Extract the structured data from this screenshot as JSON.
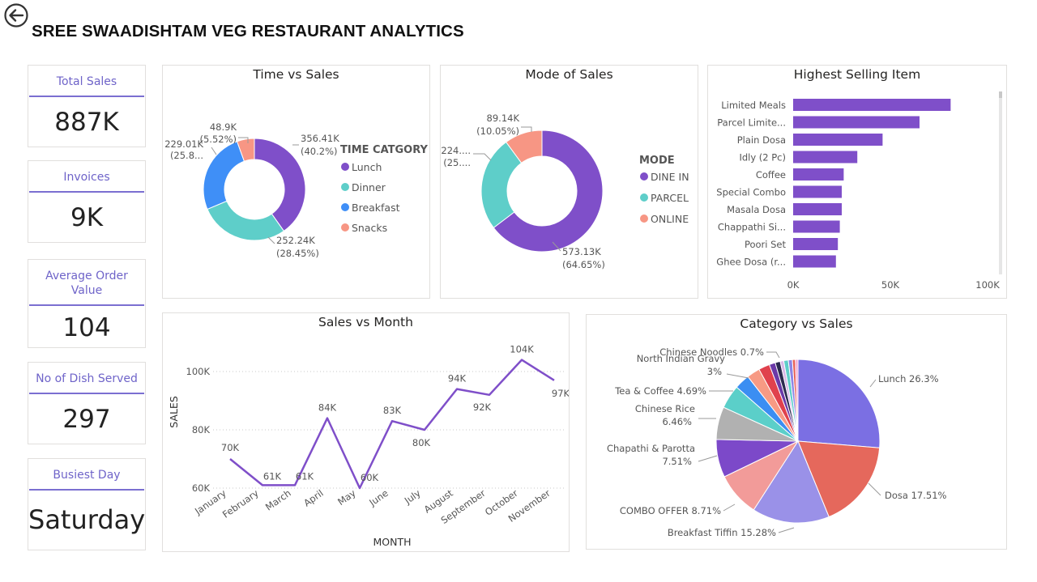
{
  "title": "SREE SWAADISHTAM VEG RESTAURANT ANALYTICS",
  "icons": {
    "back": "back-arrow-icon"
  },
  "colors": {
    "purple": "#7f4fc9",
    "teal": "#5ecec9",
    "blue": "#3f8ff7",
    "salmon": "#f79684",
    "kpi_accent": "#7b6fd1"
  },
  "kpis": [
    {
      "label": "Total Sales",
      "value": "887K"
    },
    {
      "label": "Invoices",
      "value": "9K"
    },
    {
      "label_lines": [
        "Average Order",
        "Value"
      ],
      "value": "104"
    },
    {
      "label": "No of Dish Served",
      "value": "297"
    },
    {
      "label": "Busiest Day",
      "value": "Saturday"
    }
  ],
  "chart_data": [
    {
      "type": "pie",
      "title": "Time vs Sales",
      "legend_title": "TIME CATGORY",
      "legend_position": "right",
      "slices": [
        {
          "name": "Lunch",
          "value": 356.41,
          "value_label": "356.41K",
          "pct_label": "(40.2%)",
          "pct": 40.2
        },
        {
          "name": "Dinner",
          "value": 252.24,
          "value_label": "252.24K",
          "pct_label": "(28.45%)",
          "pct": 28.45
        },
        {
          "name": "Breakfast",
          "value": 229.01,
          "value_label": "229.01K",
          "pct_label": "(25.8...",
          "pct": 25.83
        },
        {
          "name": "Snacks",
          "value": 48.9,
          "value_label": "48.9K",
          "pct_label": "(5.52%)",
          "pct": 5.52
        }
      ]
    },
    {
      "type": "pie",
      "title": "Mode of Sales",
      "legend_title": "MODE",
      "legend_position": "right",
      "slices": [
        {
          "name": "DINE IN",
          "value": 573.13,
          "value_label": "573.13K",
          "pct_label": "(64.65%)",
          "pct": 64.65
        },
        {
          "name": "PARCEL",
          "value": 224,
          "value_label": "224....",
          "pct_label": "(25....",
          "pct": 25.3
        },
        {
          "name": "ONLINE",
          "value": 89.14,
          "value_label": "89.14K",
          "pct_label": "(10.05%)",
          "pct": 10.05
        }
      ]
    },
    {
      "type": "bar",
      "orientation": "horizontal",
      "title": "Highest Selling Item",
      "categories": [
        "Limited Meals",
        "Parcel Limite...",
        "Plain Dosa",
        "Idly (2 Pc)",
        "Coffee",
        "Special Combo",
        "Masala Dosa",
        "Chappathi Si...",
        "Poori Set",
        "Ghee Dosa (r..."
      ],
      "values": [
        81,
        65,
        46,
        33,
        26,
        25,
        25,
        24,
        23,
        22
      ],
      "xlim": [
        0,
        100
      ],
      "xticks": [
        "0K",
        "50K",
        "100K"
      ],
      "gridlines": false
    },
    {
      "type": "line",
      "title": "Sales vs Month",
      "xlabel": "MONTH",
      "ylabel": "SALES",
      "categories": [
        "January",
        "February",
        "March",
        "April",
        "May",
        "June",
        "July",
        "August",
        "September",
        "October",
        "November"
      ],
      "values": [
        70,
        61,
        61,
        84,
        60,
        83,
        80,
        94,
        92,
        104,
        97
      ],
      "data_labels": [
        "70K",
        "61K",
        "61K",
        "84K",
        "60K",
        "83K",
        "80K",
        "94K",
        "92K",
        "104K",
        "97K"
      ],
      "ylim": [
        60,
        104
      ],
      "yticks": [
        {
          "v": 60,
          "label": "60K"
        },
        {
          "v": 80,
          "label": "80K"
        },
        {
          "v": 100,
          "label": "100K"
        }
      ],
      "grid": true
    },
    {
      "type": "pie",
      "title": "Category vs Sales",
      "slices": [
        {
          "name": "Lunch",
          "pct": 26.3,
          "label": "Lunch 26.3%",
          "color": "#7b6fe3"
        },
        {
          "name": "Dosa",
          "pct": 17.51,
          "label": "Dosa 17.51%",
          "color": "#e5685c"
        },
        {
          "name": "Breakfast Tiffin",
          "pct": 15.28,
          "label": "Breakfast Tiffin 15.28%",
          "color": "#9a91e8"
        },
        {
          "name": "COMBO OFFER",
          "pct": 8.71,
          "label": "COMBO OFFER 8.71%",
          "color": "#f29b99"
        },
        {
          "name": "Chapathi & Parotta",
          "pct": 7.51,
          "label_lines": [
            "Chapathi & Parotta",
            "7.51%"
          ],
          "color": "#7c49c9"
        },
        {
          "name": "Chinese Rice",
          "pct": 6.46,
          "label_lines": [
            "Chinese Rice",
            "6.46%"
          ],
          "color": "#b1b1b1"
        },
        {
          "name": "Tea & Coffee",
          "pct": 4.69,
          "label": "Tea & Coffee 4.69%",
          "color": "#5bcfc9"
        },
        {
          "name": "North Indian Gravy",
          "pct": 3,
          "label_lines": [
            "North Indian Gravy",
            "3%"
          ],
          "color": "#3b8ef2"
        },
        {
          "name": "s9",
          "pct": 2.6,
          "color": "#f79a84"
        },
        {
          "name": "s10",
          "pct": 2.2,
          "color": "#e0414d"
        },
        {
          "name": "s11",
          "pct": 1.2,
          "color": "#6b3aa8"
        },
        {
          "name": "s12",
          "pct": 1.0,
          "color": "#2b2b4f"
        },
        {
          "name": "Chinese Noodles",
          "pct": 0.7,
          "label": "Chinese Noodles 0.7%",
          "color": "#d9b7e8"
        },
        {
          "name": "s14",
          "pct": 0.9,
          "color": "#5ecec9"
        },
        {
          "name": "s15",
          "pct": 0.8,
          "color": "#8d84e6"
        },
        {
          "name": "s16",
          "pct": 0.6,
          "color": "#e8615a"
        },
        {
          "name": "s17",
          "pct": 0.5,
          "color": "#f3a0d0"
        }
      ]
    }
  ]
}
